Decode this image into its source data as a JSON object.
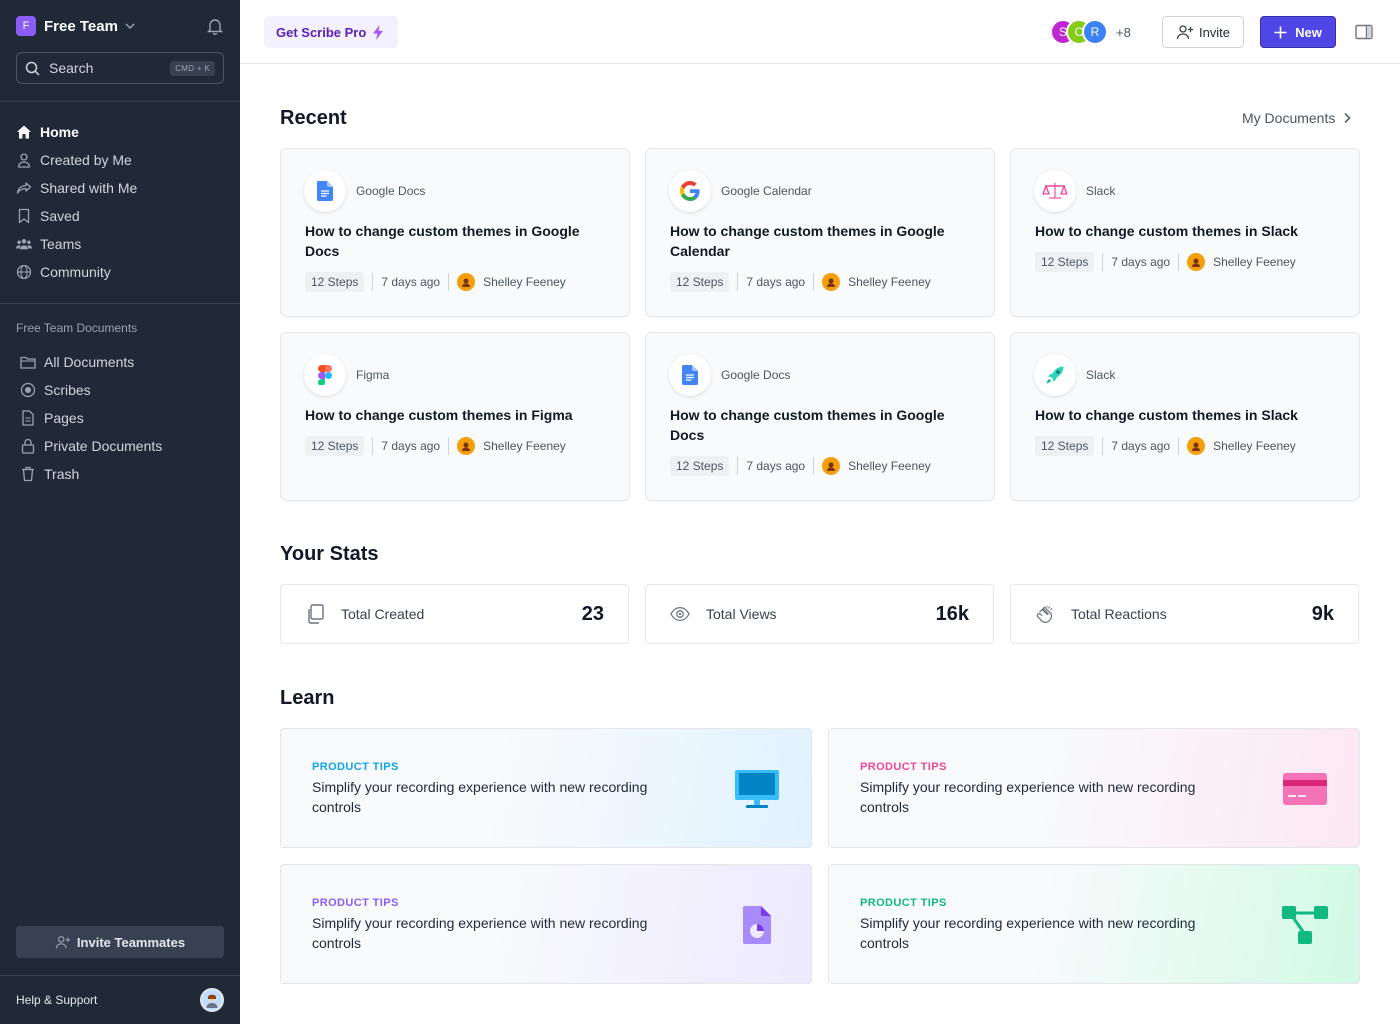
{
  "sidebar": {
    "team_initial": "F",
    "team_name": "Free Team",
    "search_label": "Search",
    "search_shortcut": "CMD + K",
    "nav": [
      {
        "label": "Home",
        "icon": "home-icon",
        "active": true
      },
      {
        "label": "Created by Me",
        "icon": "user-icon"
      },
      {
        "label": "Shared with Me",
        "icon": "share-icon"
      },
      {
        "label": "Saved",
        "icon": "bookmark-icon"
      },
      {
        "label": "Teams",
        "icon": "users-icon"
      },
      {
        "label": "Community",
        "icon": "globe-icon"
      }
    ],
    "section_title": "Free Team Documents",
    "docs_nav": [
      {
        "label": "All Documents",
        "icon": "folder-icon"
      },
      {
        "label": "Scribes",
        "icon": "record-icon"
      },
      {
        "label": "Pages",
        "icon": "page-icon"
      },
      {
        "label": "Private Documents",
        "icon": "lock-icon"
      },
      {
        "label": "Trash",
        "icon": "trash-icon"
      }
    ],
    "invite_label": "Invite Teammates",
    "help_label": "Help & Support"
  },
  "topbar": {
    "pro_label": "Get Scribe Pro",
    "avatars": [
      {
        "initial": "S",
        "color": "#c026d3"
      },
      {
        "initial": "C",
        "color": "#84cc16"
      },
      {
        "initial": "R",
        "color": "#3b82f6"
      }
    ],
    "avatars_more": "+8",
    "invite_label": "Invite",
    "new_label": "New"
  },
  "main": {
    "recent_title": "Recent",
    "my_documents_label": "My Documents",
    "recent": [
      {
        "app": "Google Docs",
        "icon": "google-docs-icon",
        "title": "How to change custom themes in Google Docs",
        "steps": "12 Steps",
        "time": "7 days ago",
        "author": "Shelley Feeney"
      },
      {
        "app": "Google Calendar",
        "icon": "google-icon",
        "title": "How to change custom themes in Google Calendar",
        "steps": "12 Steps",
        "time": "7 days ago",
        "author": "Shelley Feeney"
      },
      {
        "app": "Slack",
        "icon": "slack-scale-icon",
        "title": "How to change custom themes in Slack",
        "steps": "12 Steps",
        "time": "7 days ago",
        "author": "Shelley Feeney"
      },
      {
        "app": "Figma",
        "icon": "figma-icon",
        "title": "How to change custom themes in Figma",
        "steps": "12 Steps",
        "time": "7 days ago",
        "author": "Shelley Feeney"
      },
      {
        "app": "Google Docs",
        "icon": "google-docs-icon",
        "title": "How to change custom themes in Google Docs",
        "steps": "12 Steps",
        "time": "7 days ago",
        "author": "Shelley Feeney"
      },
      {
        "app": "Slack",
        "icon": "slack-rocket-icon",
        "title": "How to change custom themes in Slack",
        "steps": "12 Steps",
        "time": "7 days ago",
        "author": "Shelley Feeney"
      }
    ],
    "stats_title": "Your Stats",
    "stats": [
      {
        "label": "Total Created",
        "value": "23",
        "icon": "copy-icon"
      },
      {
        "label": "Total Views",
        "value": "16k",
        "icon": "eye-icon"
      },
      {
        "label": "Total Reactions",
        "value": "9k",
        "icon": "clap-icon"
      }
    ],
    "learn_title": "Learn",
    "learn": [
      {
        "tag": "PRODUCT TIPS",
        "text": "Simplify your recording experience with new recording controls",
        "color": "#0ea5e9",
        "icon": "monitor-icon"
      },
      {
        "tag": "PRODUCT TIPS",
        "text": "Simplify your recording experience with new recording controls",
        "color": "#ec4899",
        "icon": "credit-card-icon"
      },
      {
        "tag": "PRODUCT TIPS",
        "text": "Simplify your recording experience with new recording controls",
        "color": "#8b5cf6",
        "icon": "file-chart-icon"
      },
      {
        "tag": "PRODUCT TIPS",
        "text": "Simplify your recording experience with new recording controls",
        "color": "#10b981",
        "icon": "flow-icon"
      }
    ]
  }
}
